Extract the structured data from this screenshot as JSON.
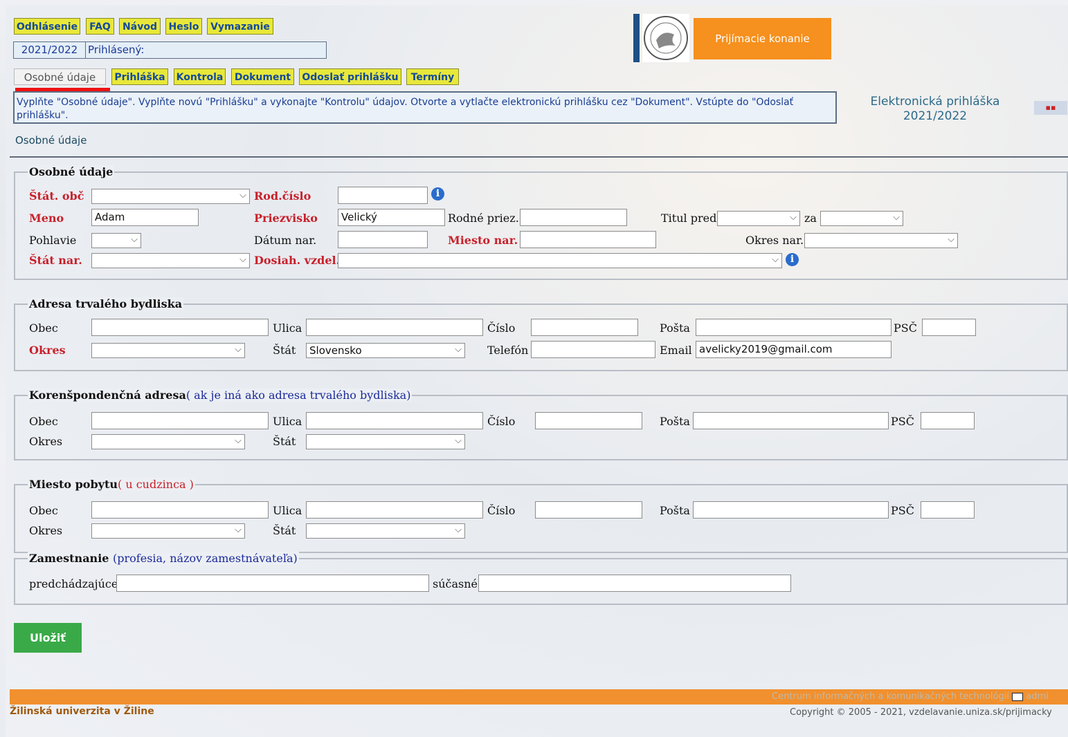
{
  "topnav": [
    "Odhlásenie",
    "FAQ",
    "Návod",
    "Heslo",
    "Vymazanie"
  ],
  "year": "2021/2022",
  "logged_in_label": "Prihlásený:",
  "tabs": [
    "Osobné údaje",
    "Prihláška",
    "Kontrola",
    "Dokument",
    "Odoslať prihlášku",
    "Termíny"
  ],
  "info_text": "Vyplňte \"Osobné údaje\". Vyplňte novú \"Prihlášku\" a vykonajte \"Kontrolu\" údajov. Otvorte a vytlačte elektronickú prihlášku cez \"Dokument\". Vstúpte do \"Odoslať prihlášku\".",
  "banner_button": "Prijímacie konanie",
  "app_title": "Elektronická prihláška",
  "app_year": "2021/2022",
  "breadcrumb": "Osobné údaje",
  "colors": {
    "tab_yellow": "#e8e83a",
    "orange": "#f1902e",
    "save_green": "#3aaa48",
    "label_red": "#c8202a"
  },
  "osobne": {
    "legend": "Osobné údaje",
    "stat_obc": "Štát. obč",
    "rod_cislo": "Rod.číslo",
    "meno": "Meno",
    "meno_val": "Adam",
    "priezvisko": "Priezvisko",
    "priezvisko_val": "Velický",
    "rodne_priez": "Rodné priez.",
    "titul_pred": "Titul pred",
    "za": "za",
    "pohlavie": "Pohlavie",
    "datum_nar": "Dátum nar.",
    "miesto_nar": "Miesto nar.",
    "okres_nar": "Okres nar.",
    "stat_nar": "Štát nar.",
    "dosiah_vzdel": "Dosiah. vzdel."
  },
  "trvale": {
    "legend": "Adresa trvalého bydliska",
    "obec": "Obec",
    "ulica": "Ulica",
    "cislo": "Číslo",
    "posta": "Pošta",
    "psc": "PSČ",
    "okres": "Okres",
    "stat": "Štát",
    "stat_val": "Slovensko",
    "telefon": "Telefón",
    "email": "Email",
    "email_val": "avelicky2019@gmail.com"
  },
  "koresp": {
    "legend": "Korenšpondenčná adresa",
    "legend_note": "( ak je iná ako adresa trvalého bydliska)",
    "obec": "Obec",
    "ulica": "Ulica",
    "cislo": "Číslo",
    "posta": "Pošta",
    "psc": "PSČ",
    "okres": "Okres",
    "stat": "Štát"
  },
  "pobyt": {
    "legend": "Miesto pobytu",
    "legend_note": "( u cudzinca )",
    "obec": "Obec",
    "ulica": "Ulica",
    "cislo": "Číslo",
    "posta": "Pošta",
    "psc": "PSČ",
    "okres": "Okres",
    "stat": "Štát"
  },
  "zamest": {
    "legend": "Zamestnanie",
    "legend_note": "(profesia, názov zamestnávateľa)",
    "predch": "predchádzajúce",
    "sucasne": "súčasné"
  },
  "save_label": "Uložiť",
  "footer": {
    "university": "Žilinská univerzita v Žiline",
    "center": "Centrum informačných a komunikačných technológií",
    "admin": "admi",
    "copyright": "Copyright © 2005 - 2021, vzdelavanie.uniza.sk/prijimacky"
  }
}
